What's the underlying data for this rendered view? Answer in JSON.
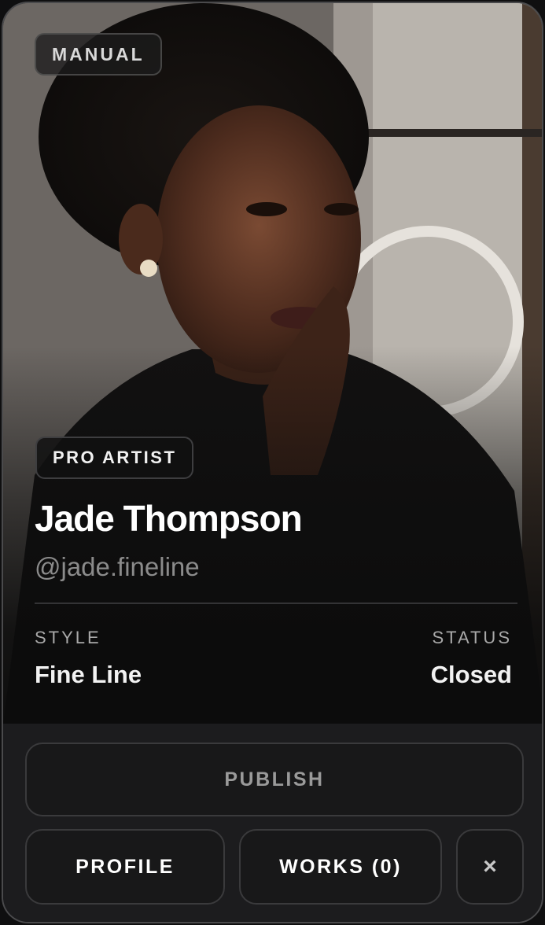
{
  "badge": "MANUAL",
  "artist": {
    "tier": "PRO ARTIST",
    "name": "Jade Thompson",
    "handle": "@jade.fineline"
  },
  "meta": {
    "style_label": "STYLE",
    "style_value": "Fine Line",
    "status_label": "STATUS",
    "status_value": "Closed"
  },
  "actions": {
    "publish": "PUBLISH",
    "profile": "PROFILE",
    "works": "WORKS (0)",
    "close": "×"
  },
  "icons": {
    "close": "close-icon"
  }
}
